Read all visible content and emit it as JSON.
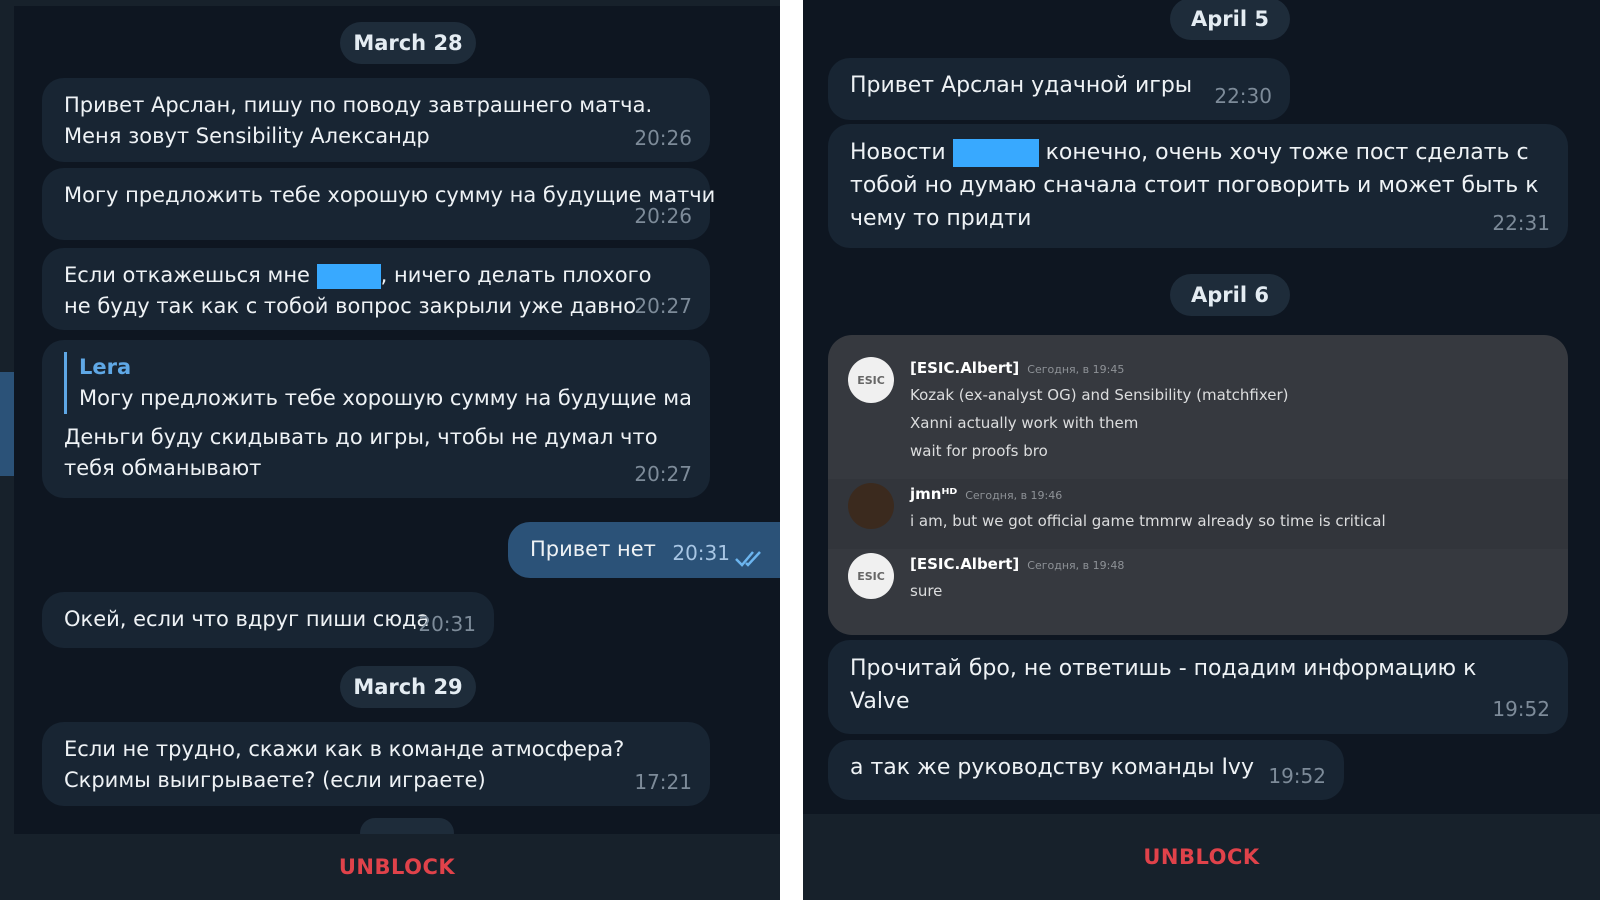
{
  "left": {
    "dates": [
      "March 28",
      "March 29"
    ],
    "messages": [
      {
        "text": "Привет Арслан, пишу по поводу завтрашнего матча. Меня зовут Sensibility Александр",
        "time": "20:26"
      },
      {
        "text": "Могу предложить тебе хорошую сумму на будущие матчи",
        "time": "20:26"
      },
      {
        "text_before": "Если откажешься мне",
        "text_after": ", ничего делать плохого не буду так как с тобой вопрос закрыли уже давно",
        "time": "20:27"
      },
      {
        "reply_name": "Lera",
        "reply_text": "Могу предложить тебе хорошую сумму на будущие ма...",
        "text": "Деньги буду скидывать до игры, чтобы не думал что тебя обманывают",
        "time": "20:27"
      },
      {
        "text": "Привет нет",
        "time": "20:31",
        "outgoing": true
      },
      {
        "text": "Окей, если что вдруг пиши сюда",
        "time": "20:31"
      },
      {
        "text": "Если не трудно, скажи как в команде атмосфера? Скримы выигрываете? (если играете)",
        "time": "17:21"
      }
    ],
    "unblock": "UNBLOCK"
  },
  "right": {
    "dates": [
      "April 5",
      "April 6"
    ],
    "messages": [
      {
        "text": "Привет Арслан удачной игры",
        "time": "22:30"
      },
      {
        "text_before": "Новости",
        "text_after": "конечно, очень хочу тоже пост сделать с тобой но думаю сначала стоит поговорить и может быть к чему то придти",
        "time": "22:31"
      },
      {
        "text": "Прочитай бро, не ответишь - подадим информацию к Valve",
        "time": "19:52"
      },
      {
        "text": "а так же руководству команды Ivy",
        "time": "19:52"
      }
    ],
    "embed": [
      {
        "author": "[ESIC.Albert]",
        "meta": "Сегодня, в 19:45",
        "avatar": "ESIC",
        "lines": [
          "Kozak (ex-analyst OG) and Sensibility (matchfixer)",
          "Xanni actually work with them",
          "wait for proofs bro"
        ]
      },
      {
        "author": "jmnᴴᴰ",
        "meta": "Сегодня, в 19:46",
        "avatar": "",
        "lines": [
          "i am, but we got official game tmmrw already so time is critical"
        ]
      },
      {
        "author": "[ESIC.Albert]",
        "meta": "Сегодня, в 19:48",
        "avatar": "ESIC",
        "lines": [
          "sure"
        ]
      }
    ],
    "unblock": "UNBLOCK"
  },
  "colors": {
    "background": "#0e1621",
    "incoming_bubble": "#182533",
    "outgoing_bubble": "#2b5278",
    "accent_name": "#5fa8e6",
    "unblock": "#e0424a",
    "redaction": "#38a9ff"
  }
}
